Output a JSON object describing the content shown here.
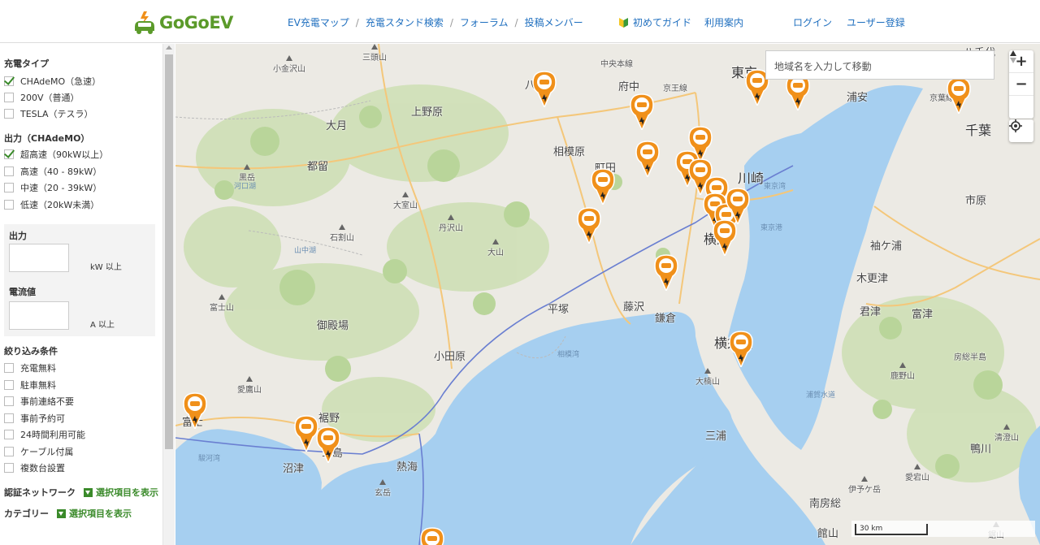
{
  "header": {
    "logo_text": "GoGoEV",
    "nav_main": [
      "EV充電マップ",
      "充電スタンド検索",
      "フォーラム",
      "投稿メンバー"
    ],
    "nav_guide": [
      "初めてガイド",
      "利用案内"
    ],
    "nav_auth": [
      "ログイン",
      "ユーザー登録"
    ]
  },
  "sidebar": {
    "charge_type_title": "充電タイプ",
    "charge_types": [
      {
        "label": "CHAdeMO（急速）",
        "checked": true
      },
      {
        "label": "200V（普通）",
        "checked": false
      },
      {
        "label": "TESLA（テスラ）",
        "checked": false
      }
    ],
    "output_title": "出力（CHAdeMO）",
    "outputs": [
      {
        "label": "超高速（90kW以上）",
        "checked": true
      },
      {
        "label": "高速（40 - 89kW）",
        "checked": false
      },
      {
        "label": "中速（20 - 39kW）",
        "checked": false
      },
      {
        "label": "低速（20kW未満）",
        "checked": false
      }
    ],
    "power_label": "出力",
    "power_unit": "kW 以上",
    "current_label": "電流値",
    "current_unit": "A 以上",
    "filter_title": "絞り込み条件",
    "filters": [
      {
        "label": "充電無料",
        "checked": false
      },
      {
        "label": "駐車無料",
        "checked": false
      },
      {
        "label": "事前連絡不要",
        "checked": false
      },
      {
        "label": "事前予約可",
        "checked": false
      },
      {
        "label": "24時間利用可能",
        "checked": false
      },
      {
        "label": "ケーブル付属",
        "checked": false
      },
      {
        "label": "複数台設置",
        "checked": false
      }
    ],
    "network_label": "認証ネットワーク",
    "category_label": "カテゴリー",
    "show_selected": "選択項目を表示"
  },
  "map": {
    "search_placeholder": "地域名を入力して移動",
    "zoom_in": "+",
    "zoom_out": "−",
    "scale_label": "30 km",
    "places": [
      {
        "name": "小金沢山",
        "cls": "mtn"
      },
      {
        "name": "三頭山",
        "cls": "mtn"
      },
      {
        "name": "上野原",
        "cls": ""
      },
      {
        "name": "大月",
        "cls": ""
      },
      {
        "name": "都留",
        "cls": ""
      },
      {
        "name": "黒岳",
        "cls": "mtn"
      },
      {
        "name": "河口湖",
        "cls": "sea"
      },
      {
        "name": "大室山",
        "cls": "mtn"
      },
      {
        "name": "丹沢山",
        "cls": "mtn"
      },
      {
        "name": "大山",
        "cls": "mtn"
      },
      {
        "name": "石割山",
        "cls": "mtn"
      },
      {
        "name": "山中湖",
        "cls": "sea"
      },
      {
        "name": "富士山",
        "cls": "mtn"
      },
      {
        "name": "御殿場",
        "cls": ""
      },
      {
        "name": "愛鷹山",
        "cls": "mtn"
      },
      {
        "name": "富士",
        "cls": ""
      },
      {
        "name": "裾野",
        "cls": ""
      },
      {
        "name": "沼津",
        "cls": ""
      },
      {
        "name": "三島",
        "cls": ""
      },
      {
        "name": "熱海",
        "cls": ""
      },
      {
        "name": "玄岳",
        "cls": "mtn"
      },
      {
        "name": "駿河湾",
        "cls": "sea"
      },
      {
        "name": "相模湾",
        "cls": "sea"
      },
      {
        "name": "小田原",
        "cls": ""
      },
      {
        "name": "平塚",
        "cls": ""
      },
      {
        "name": "藤沢",
        "cls": ""
      },
      {
        "name": "鎌倉",
        "cls": ""
      },
      {
        "name": "相模原",
        "cls": ""
      },
      {
        "name": "町田",
        "cls": ""
      },
      {
        "name": "八王子",
        "cls": ""
      },
      {
        "name": "府中",
        "cls": ""
      },
      {
        "name": "東京",
        "cls": "big"
      },
      {
        "name": "川崎",
        "cls": "big"
      },
      {
        "name": "横浜",
        "cls": "big"
      },
      {
        "name": "横須賀",
        "cls": "big"
      },
      {
        "name": "大楠山",
        "cls": "mtn"
      },
      {
        "name": "三浦",
        "cls": ""
      },
      {
        "name": "東京湾",
        "cls": "sea"
      },
      {
        "name": "浦賀水道",
        "cls": "sea"
      },
      {
        "name": "浦安",
        "cls": ""
      },
      {
        "name": "千葉",
        "cls": "big"
      },
      {
        "name": "市原",
        "cls": ""
      },
      {
        "name": "袖ケ浦",
        "cls": ""
      },
      {
        "name": "木更津",
        "cls": ""
      },
      {
        "name": "君津",
        "cls": ""
      },
      {
        "name": "富津",
        "cls": ""
      },
      {
        "name": "鹿野山",
        "cls": "mtn"
      },
      {
        "name": "房総半島",
        "cls": "small"
      },
      {
        "name": "伊予ケ岳",
        "cls": "mtn"
      },
      {
        "name": "愛宕山",
        "cls": "mtn"
      },
      {
        "name": "清澄山",
        "cls": "mtn"
      },
      {
        "name": "鴨川",
        "cls": ""
      },
      {
        "name": "南房総",
        "cls": ""
      },
      {
        "name": "館山",
        "cls": ""
      },
      {
        "name": "鋸山",
        "cls": "mtn"
      },
      {
        "name": "東京港",
        "cls": "sea"
      },
      {
        "name": "京葉線",
        "cls": "small"
      },
      {
        "name": "京王線",
        "cls": "small"
      },
      {
        "name": "中央本線",
        "cls": "small"
      },
      {
        "name": "八千代",
        "cls": ""
      }
    ]
  },
  "colors": {
    "brand_green": "#5b9a2a",
    "nav_blue": "#1f6fbf",
    "marker_orange": "#f0901a",
    "sea": "#a6cff0",
    "land": "#eceae4"
  }
}
